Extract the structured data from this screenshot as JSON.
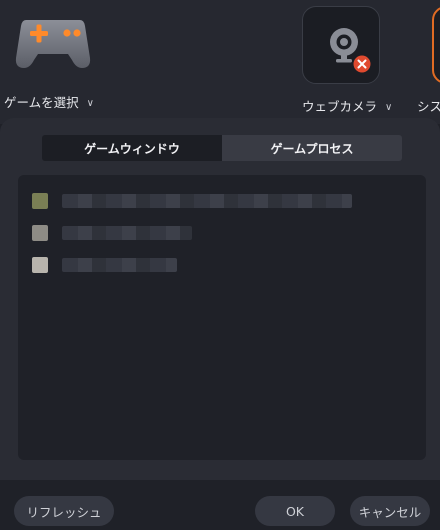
{
  "sources": {
    "game": {
      "label": "ゲームを選択",
      "icon": "gamepad-icon"
    },
    "webcam": {
      "label": "ウェブカメラ",
      "icon": "webcam-icon",
      "status_icon": "close-icon"
    },
    "system": {
      "label": "シス",
      "icon": "system-icon"
    }
  },
  "tabs": [
    {
      "label": "ゲームウィンドウ",
      "active": true
    },
    {
      "label": "ゲームプロセス",
      "active": false
    }
  ],
  "list": {
    "rows": [
      {
        "icon_color": "#7a7f55"
      },
      {
        "icon_color": "#8e8c86"
      },
      {
        "icon_color": "#b8b4ad"
      }
    ]
  },
  "footer": {
    "refresh_label": "リフレッシュ",
    "ok_label": "OK",
    "cancel_label": "キャンセル"
  },
  "colors": {
    "accent": "#ff7a2a",
    "error": "#e04a2f",
    "panel": "#2a2c34",
    "background": "#1f2128"
  }
}
